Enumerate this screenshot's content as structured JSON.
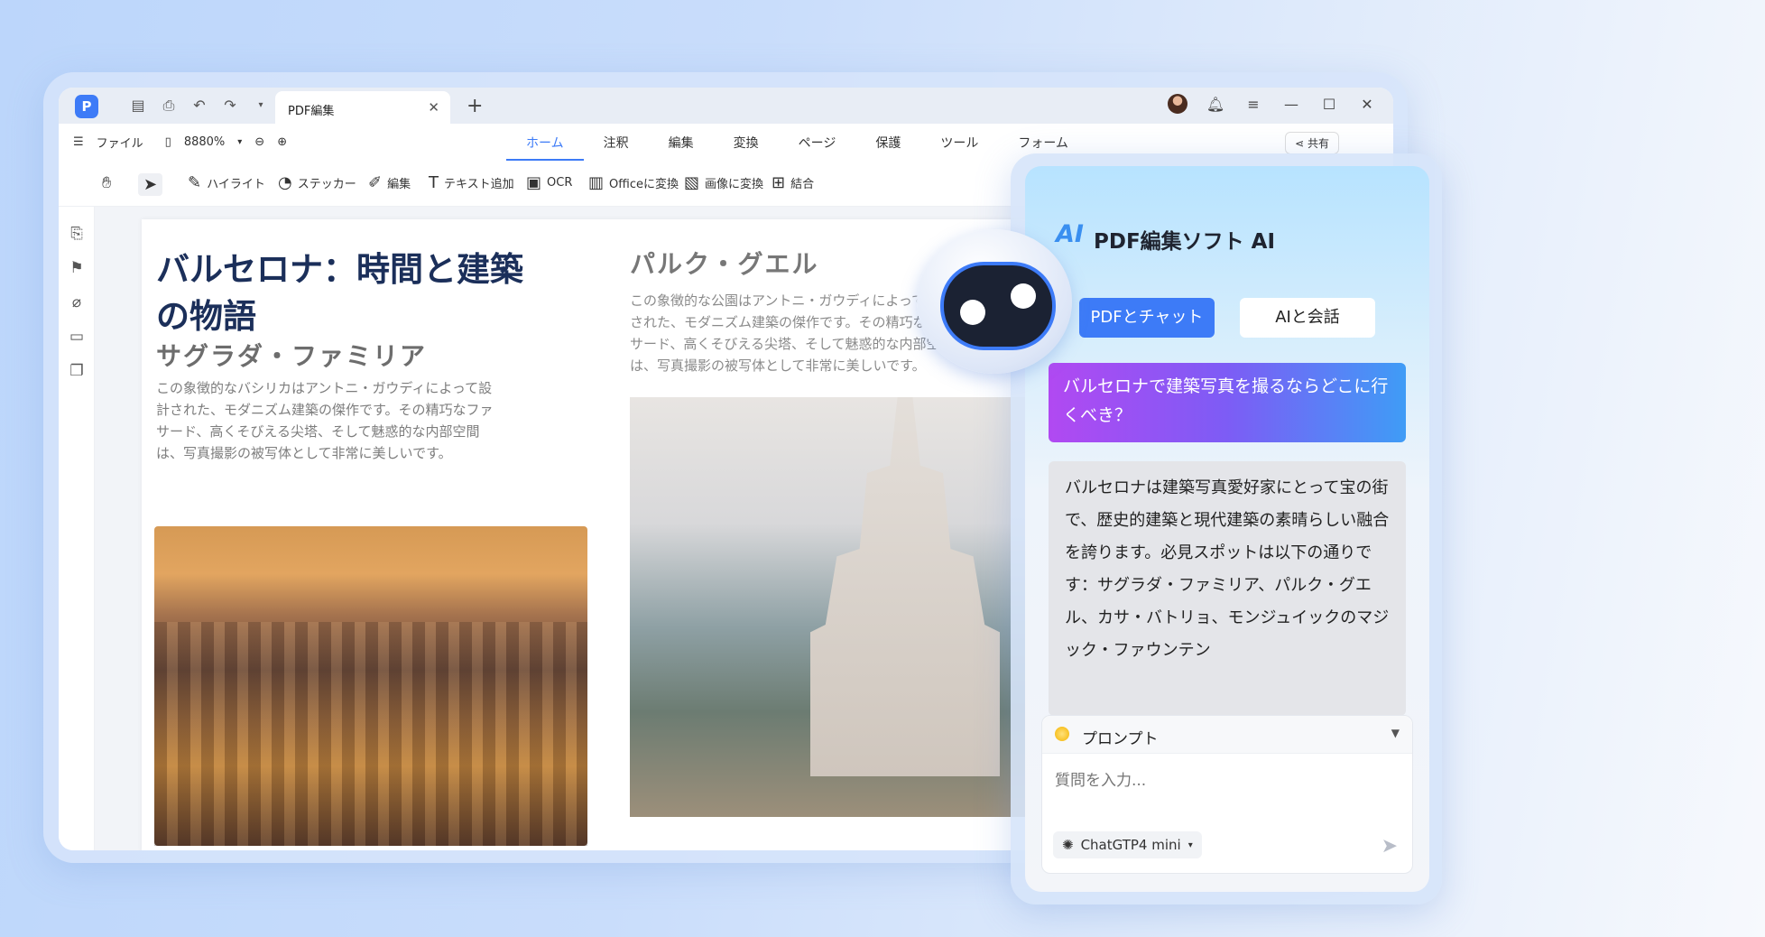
{
  "app": {
    "logo": "P",
    "tab_title": "PDF編集",
    "zoom": "8880%",
    "file_menu": "ファイル",
    "share_label": "共有",
    "menu_tabs": [
      "ホーム",
      "注釈",
      "編集",
      "変換",
      "ページ",
      "保護",
      "ツール",
      "フォーム"
    ],
    "tools": {
      "highlight": "ハイライト",
      "sticker": "ステッカー",
      "edit": "編集",
      "add_text": "テキスト追加",
      "ocr": "OCR",
      "to_office": "Officeに変換",
      "to_image": "画像に変換",
      "combine": "結合"
    }
  },
  "document": {
    "title": "バルセロナ：時間と建築の物語",
    "section1_heading": "サグラダ・ファミリア",
    "section1_body": "この象徴的なバシリカはアントニ・ガウディによって設計された、モダニズム建築の傑作です。その精巧なファサード、高くそびえる尖塔、そして魅惑的な内部空間は、写真撮影の被写体として非常に美しいです。",
    "section2_heading": "パルク・グエル",
    "section2_body": "この象徴的な公園はアントニ・ガウディによって設計された、モダニズム建築の傑作です。その精巧なファサード、高くそびえる尖塔、そして魅惑的な内部空間は、写真撮影の被写体として非常に美しいです。"
  },
  "ai": {
    "logo": "AI",
    "title": "PDF編集ソフト AI",
    "tab_chat_pdf": "PDFとチャット",
    "tab_chat_ai": "AIと会話",
    "question": "バルセロナで建築写真を撮るならどこに行くべき？",
    "answer": "バルセロナは建築写真愛好家にとって宝の街で、歴史的建築と現代建築の素晴らしい融合を誇ります。必見スポットは以下の通りです：サグラダ・ファミリア、パルク・グエル、カサ・バトリョ、モンジュイックのマジック・ファウンテン",
    "prompt_label": "プロンプト",
    "input_placeholder": "質問を入力...",
    "model": "ChatGTP4 mini"
  },
  "colors": {
    "accent": "#3d7bf7",
    "title_navy": "#1b2f5a"
  }
}
